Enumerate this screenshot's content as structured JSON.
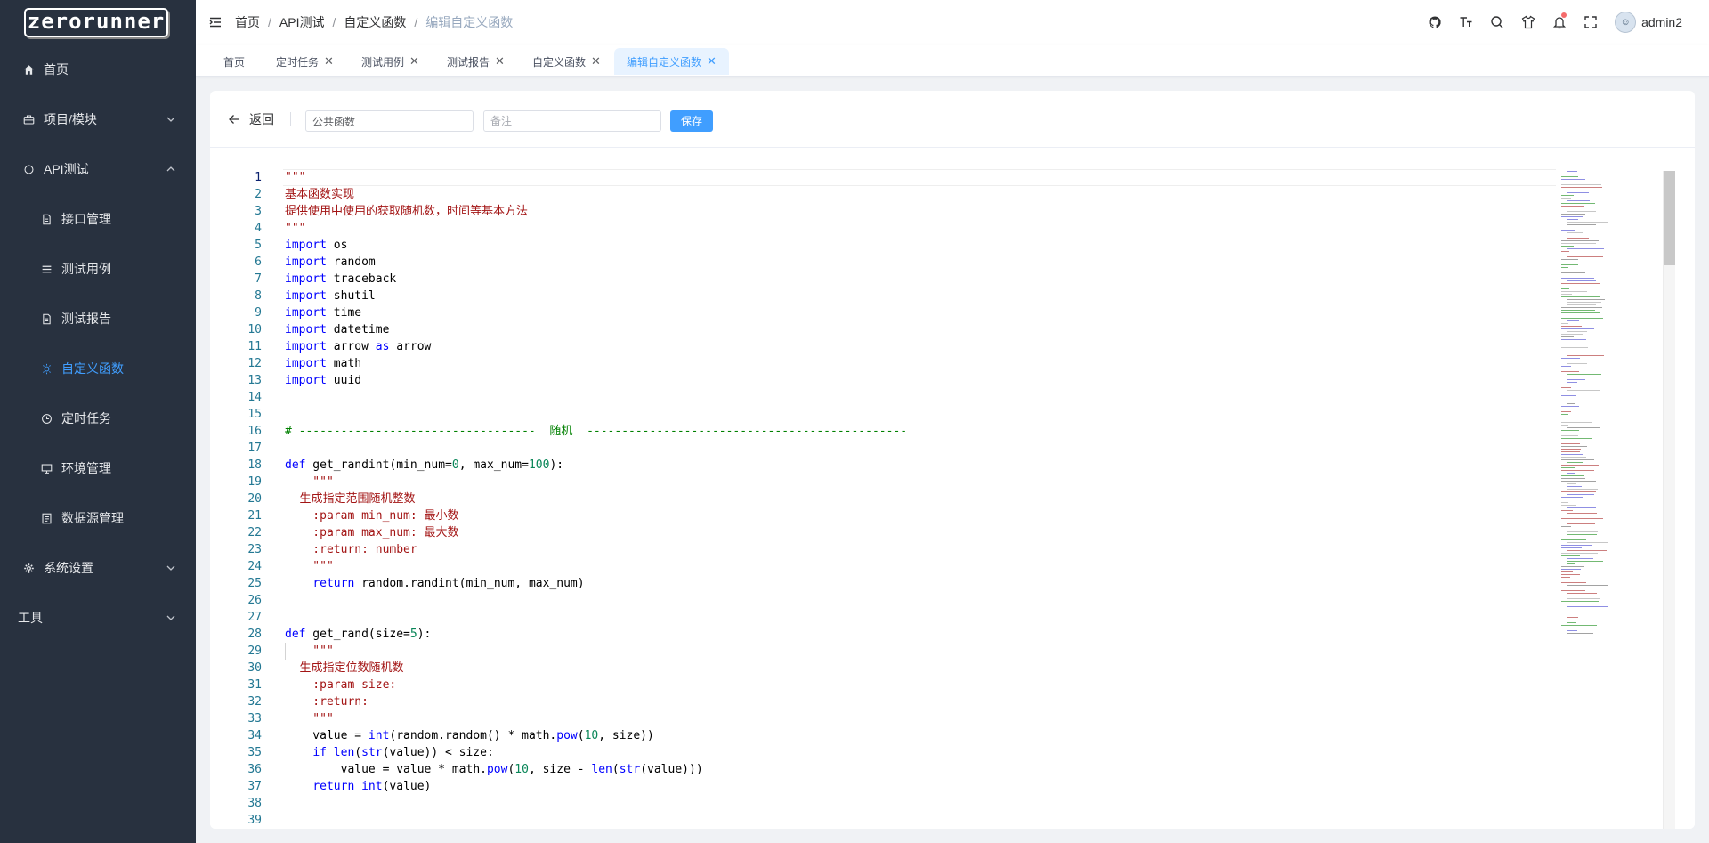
{
  "logo": {
    "text": "zerorunner"
  },
  "sidebar": {
    "items": [
      {
        "label": "首页",
        "icon": "home-icon"
      },
      {
        "label": "项目/模块",
        "icon": "briefcase-icon"
      },
      {
        "label": "API测试",
        "icon": "api-icon"
      },
      {
        "label": "接口管理",
        "icon": "document-icon"
      },
      {
        "label": "测试用例",
        "icon": "list-icon"
      },
      {
        "label": "测试报告",
        "icon": "document-icon"
      },
      {
        "label": "自定义函数",
        "icon": "sun-icon"
      },
      {
        "label": "定时任务",
        "icon": "clock-icon"
      },
      {
        "label": "环境管理",
        "icon": "monitor-icon"
      },
      {
        "label": "数据源管理",
        "icon": "tickets-icon"
      },
      {
        "label": "系统设置",
        "icon": "setting-icon"
      },
      {
        "label": "工具",
        "icon": ""
      }
    ]
  },
  "header": {
    "breadcrumb": [
      "首页",
      "API测试",
      "自定义函数",
      "编辑自定义函数"
    ],
    "user": "admin2",
    "icons": [
      "github-icon",
      "font-size-icon",
      "search-icon",
      "shirt-icon",
      "bell-icon",
      "fullscreen-icon"
    ]
  },
  "tags": [
    "首页",
    "定时任务",
    "测试用例",
    "测试报告",
    "自定义函数",
    "编辑自定义函数"
  ],
  "toolbar": {
    "back_label": "返回",
    "name_value": "公共函数",
    "remark_placeholder": "备注",
    "save_label": "保存"
  },
  "editor": {
    "line_numbers": [
      "1",
      "2",
      "3",
      "4",
      "5",
      "6",
      "7",
      "8",
      "9",
      "10",
      "11",
      "12",
      "13",
      "14",
      "15",
      "16",
      "17",
      "18",
      "19",
      "20",
      "21",
      "22",
      "23",
      "24",
      "25",
      "26",
      "27",
      "28",
      "29",
      "30",
      "31",
      "32",
      "33",
      "34",
      "35",
      "36",
      "37",
      "38",
      "39"
    ],
    "lines": [
      "\"\"\"",
      "基本函数实现",
      "提供使用中使用的获取随机数，时间等基本方法",
      "\"\"\"",
      "import os",
      "import random",
      "import traceback",
      "import shutil",
      "import time",
      "import datetime",
      "import arrow as arrow",
      "import math",
      "import uuid",
      "",
      "",
      "# ----------------------------------  随机  ----------------------------------------------",
      "",
      "def get_randint(min_num=0, max_num=100):",
      "    \"\"\"",
      "    生成指定范围随机整数",
      "    :param min_num: 最小数",
      "    :param max_num: 最大数",
      "    :return: number",
      "    \"\"\"",
      "    return random.randint(min_num, max_num)",
      "",
      "",
      "def get_rand(size=5):",
      "    \"\"\"",
      "    生成指定位数随机数",
      "    :param size:",
      "    :return:",
      "    \"\"\"",
      "    value = int(random.random() * math.pow(10, size))",
      "    if len(str(value)) < size:",
      "        value = value * math.pow(10, size - len(str(value)))",
      "    return int(value)",
      "",
      ""
    ]
  }
}
